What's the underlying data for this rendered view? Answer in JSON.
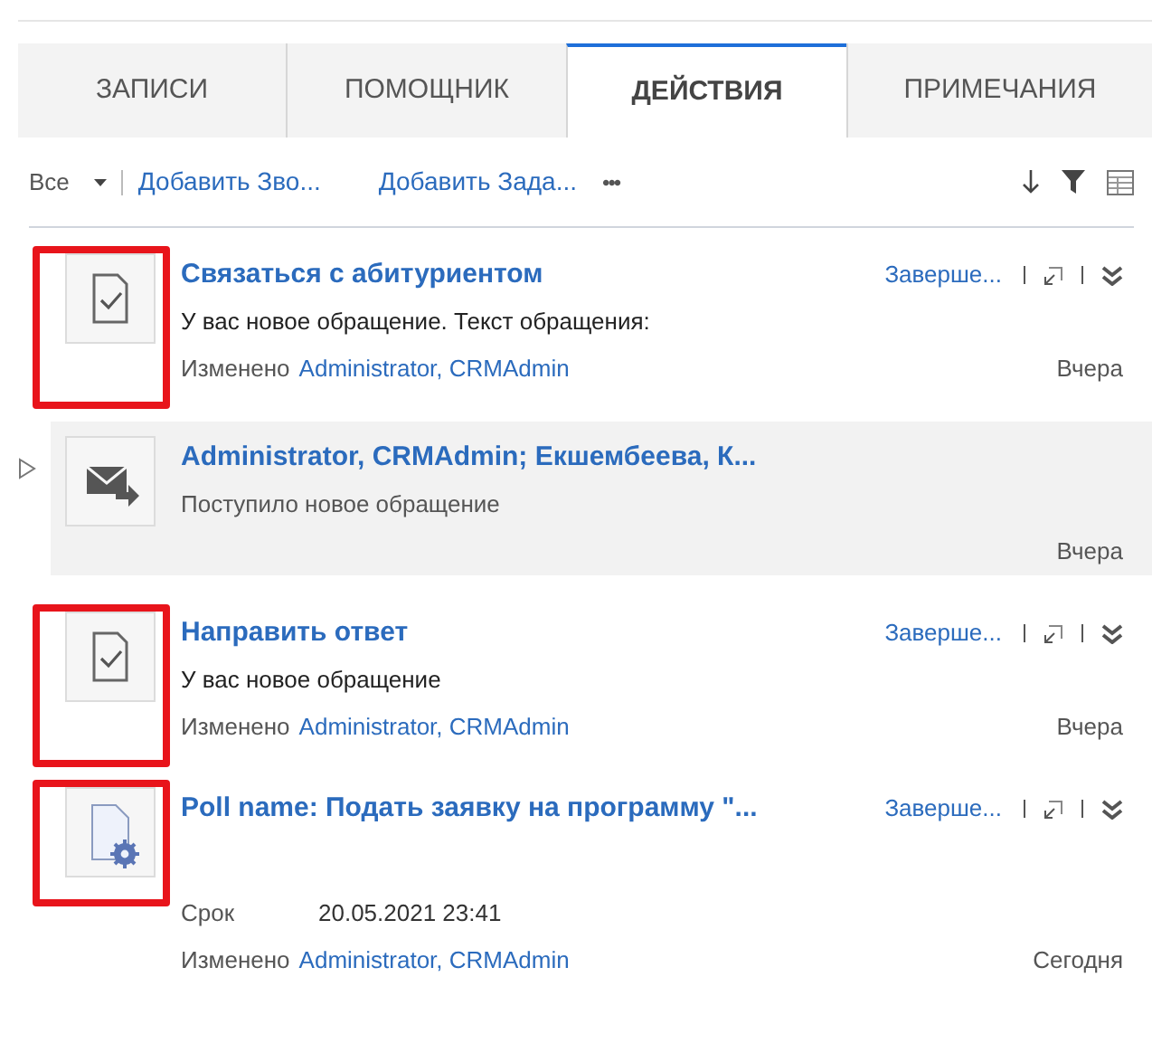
{
  "tabs": [
    {
      "label": "ЗАПИСИ",
      "selected": false
    },
    {
      "label": "ПОМОЩНИК",
      "selected": false
    },
    {
      "label": "ДЕЙСТВИЯ",
      "selected": true
    },
    {
      "label": "ПРИМЕЧАНИЯ",
      "selected": false
    }
  ],
  "toolbar": {
    "filter": "Все",
    "links": [
      "Добавить Зво...",
      "Добавить Зада..."
    ],
    "more": "•••"
  },
  "activities": [
    {
      "kind": "task",
      "highlighted": true,
      "selected": false,
      "title": "Связаться с абитуриентом",
      "action": "Заверше...",
      "description": "У вас новое обращение. Текст обращения:",
      "modified_label": "Изменено",
      "modified_by": "Administrator, CRMAdmin",
      "date": "Вчера"
    },
    {
      "kind": "email",
      "highlighted": false,
      "selected": true,
      "expanded": false,
      "title": "Administrator, CRMAdmin; Екшембеева, К...",
      "description": "Поступило новое обращение",
      "date": "Вчера"
    },
    {
      "kind": "task",
      "highlighted": true,
      "selected": false,
      "title": "Направить ответ",
      "action": "Заверше...",
      "description": "У вас новое обращение",
      "modified_label": "Изменено",
      "modified_by": "Administrator, CRMAdmin",
      "date": "Вчера"
    },
    {
      "kind": "survey",
      "highlighted": true,
      "selected": false,
      "title": "Poll name: Подать заявку на программу \"...",
      "action": "Заверше...",
      "due_label": "Срок",
      "due_value": "20.05.2021 23:41",
      "modified_label": "Изменено",
      "modified_by": "Administrator, CRMAdmin",
      "date": "Сегодня"
    }
  ]
}
